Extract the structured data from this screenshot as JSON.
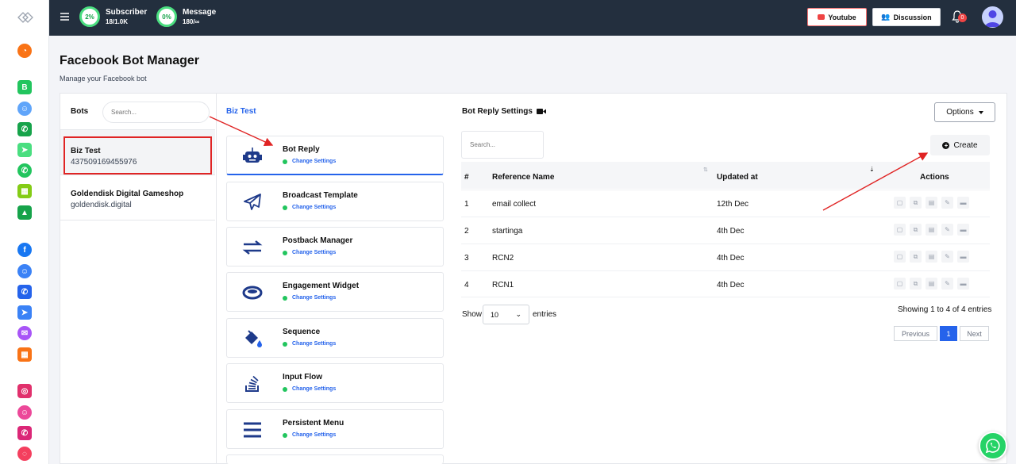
{
  "topbar": {
    "subscriber": {
      "percent": "2%",
      "label": "Subscriber",
      "value": "18/1.0K"
    },
    "message": {
      "percent": "0%",
      "label": "Message",
      "value": "180/∞"
    },
    "youtube_label": "Youtube",
    "discussion_label": "Discussion",
    "notification_count": "0"
  },
  "page": {
    "title": "Facebook Bot Manager",
    "subtitle": "Manage your Facebook bot"
  },
  "bots": {
    "header": "Bots",
    "search_placeholder": "Search...",
    "items": [
      {
        "name": "Biz Test",
        "id": "437509169455976"
      },
      {
        "name": "Goldendisk Digital Gameshop",
        "id": "goldendisk.digital"
      }
    ]
  },
  "middle": {
    "header": "Biz Test",
    "features": [
      {
        "title": "Bot Reply",
        "sub": "Change Settings"
      },
      {
        "title": "Broadcast Template",
        "sub": "Change Settings"
      },
      {
        "title": "Postback Manager",
        "sub": "Change Settings"
      },
      {
        "title": "Engagement Widget",
        "sub": "Change Settings"
      },
      {
        "title": "Sequence",
        "sub": "Change Settings"
      },
      {
        "title": "Input Flow",
        "sub": "Change Settings"
      },
      {
        "title": "Persistent Menu",
        "sub": "Change Settings"
      }
    ]
  },
  "settings": {
    "header": "Bot Reply Settings",
    "options_label": "Options",
    "search_placeholder": "Search...",
    "create_label": "Create",
    "columns": [
      "#",
      "Reference Name",
      "Updated at",
      "Actions"
    ],
    "rows": [
      {
        "num": "1",
        "name": "email collect",
        "updated": "12th Dec"
      },
      {
        "num": "2",
        "name": "startinga",
        "updated": "4th Dec"
      },
      {
        "num": "3",
        "name": "RCN2",
        "updated": "4th Dec"
      },
      {
        "num": "4",
        "name": "RCN1",
        "updated": "4th Dec"
      }
    ],
    "show_label": "Show",
    "entries_value": "10",
    "entries_label": "entries",
    "info": "Showing 1 to 4 of 4 entries",
    "prev_label": "Previous",
    "page_label": "1",
    "next_label": "Next"
  },
  "colors": {
    "topbar": "#232f3e",
    "accent": "#2563eb",
    "annotation": "#e02424",
    "status": "#22c55e"
  }
}
